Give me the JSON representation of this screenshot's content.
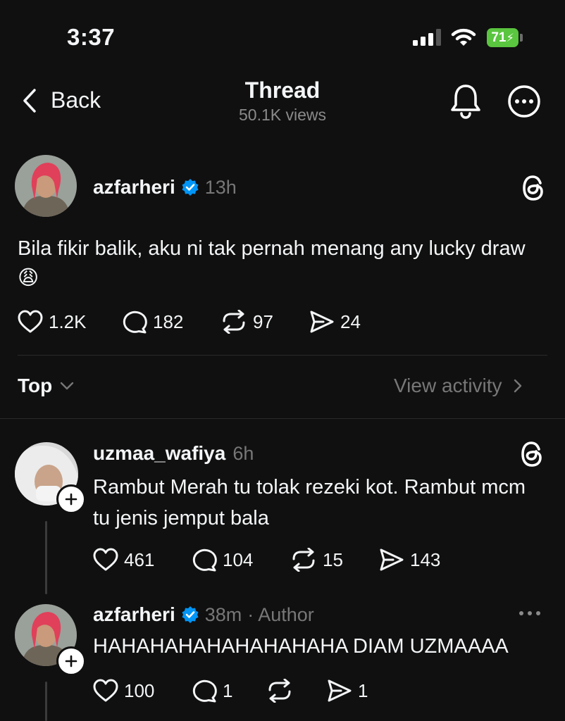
{
  "status_bar": {
    "time": "3:37",
    "battery": "71"
  },
  "nav": {
    "back_label": "Back",
    "title": "Thread",
    "views": "50.1K views"
  },
  "post": {
    "username": "azfarheri",
    "time": "13h",
    "text": "Bila fikir balik, aku ni tak pernah menang any lucky draw 😩",
    "likes": "1.2K",
    "replies": "182",
    "reposts": "97",
    "shares": "24"
  },
  "sort": {
    "label": "Top",
    "view_activity": "View activity"
  },
  "replies": [
    {
      "username": "uzmaa_wafiya",
      "time": "6h",
      "text": "Rambut Merah tu tolak rezeki kot. Rambut mcm tu jenis jemput bala",
      "likes": "461",
      "replies": "104",
      "reposts": "15",
      "shares": "143"
    },
    {
      "username": "azfarheri",
      "time": "38m",
      "author_tag": "· Author",
      "text": "HAHAHAHAHAHAHAHAHA DIAM UZMAAAA",
      "likes": "100",
      "replies": "1",
      "reposts": "",
      "shares": "1"
    }
  ],
  "colors": {
    "background": "#101010",
    "verified": "#0095f6",
    "battery": "#5ac53f"
  },
  "icons": [
    "chevron-left-icon",
    "bell-icon",
    "more-circle-icon",
    "threads-logo-icon",
    "heart-icon",
    "comment-icon",
    "repost-icon",
    "share-icon",
    "verified-badge-icon",
    "plus-icon",
    "chevron-down-icon",
    "chevron-right-icon",
    "ellipsis-icon"
  ]
}
